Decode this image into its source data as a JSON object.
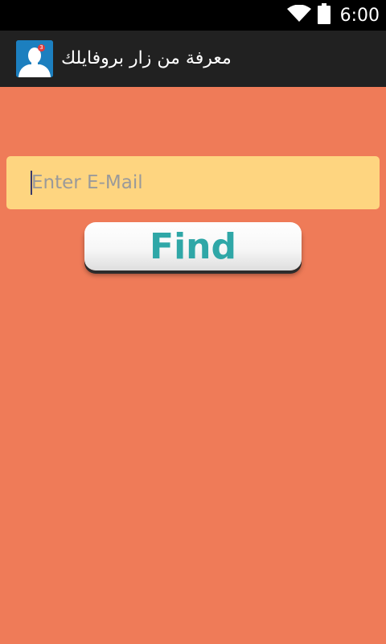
{
  "status_bar": {
    "time": "6:00",
    "icons": [
      "wifi-icon",
      "battery-icon"
    ]
  },
  "action_bar": {
    "title": "معرفة من زار بروفايلك",
    "icon": "profile-visitor-icon",
    "badge": "3"
  },
  "form": {
    "email_placeholder": "Enter E-Mail",
    "email_value": "",
    "find_label": "Find"
  },
  "colors": {
    "background": "#ef7b58",
    "field": "#fed580",
    "button_text": "#2fa7a7",
    "action_bar": "#212121"
  }
}
